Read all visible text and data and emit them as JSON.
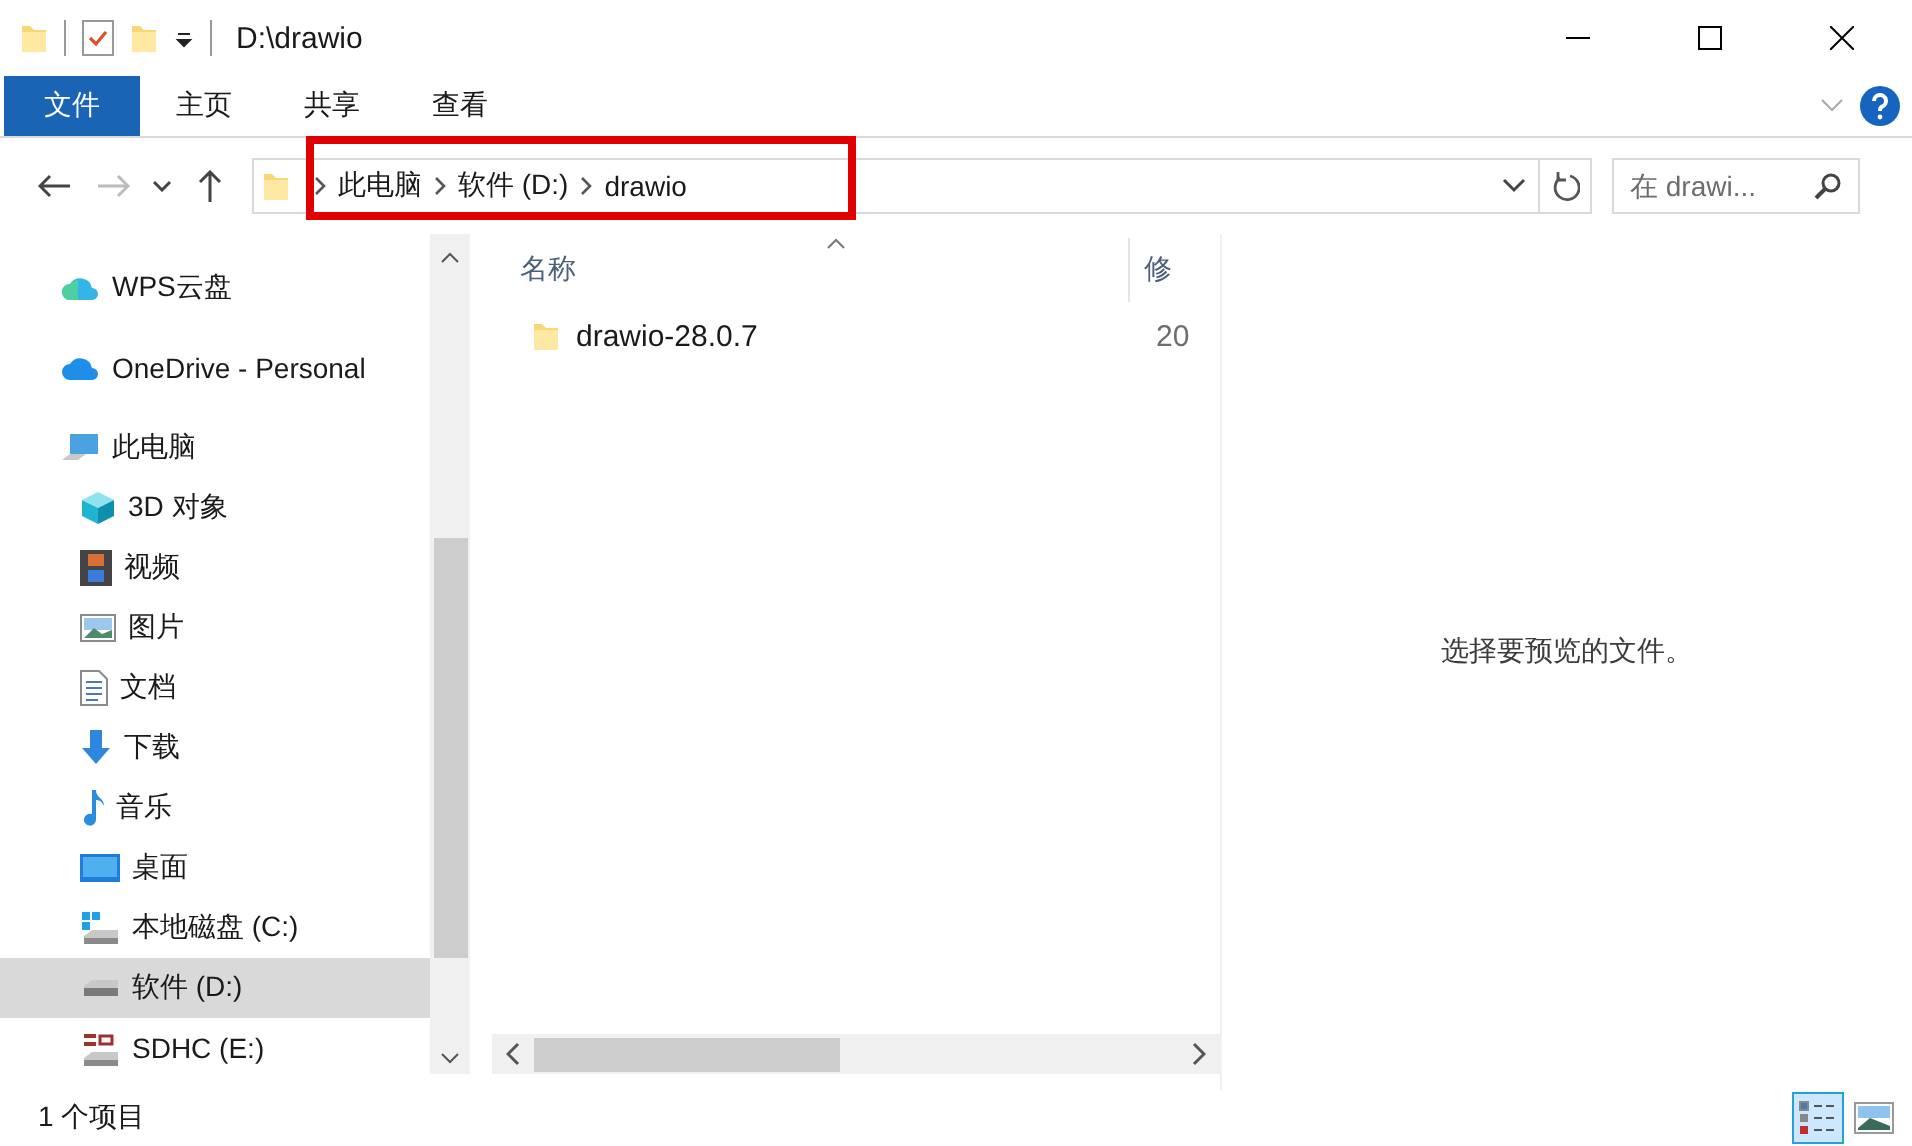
{
  "title_bar": {
    "title": "D:\\drawio"
  },
  "ribbon_tabs": [
    {
      "label": "文件",
      "selected": true
    },
    {
      "label": "主页",
      "selected": false
    },
    {
      "label": "共享",
      "selected": false
    },
    {
      "label": "查看",
      "selected": false
    }
  ],
  "address_bar": {
    "breadcrumbs": [
      "此电脑",
      "软件 (D:)",
      "drawio"
    ],
    "highlighted": true
  },
  "search": {
    "placeholder": "在 drawi..."
  },
  "nav_pane": {
    "items": [
      {
        "label": "WPS云盘",
        "kind": "cloud-wps",
        "selected": false
      },
      {
        "label": "OneDrive - Personal",
        "kind": "cloud",
        "selected": false
      },
      {
        "label": "此电脑",
        "kind": "computer",
        "selected": false,
        "children": [
          {
            "label": "3D 对象",
            "kind": "cube",
            "selected": false
          },
          {
            "label": "视频",
            "kind": "film",
            "selected": false
          },
          {
            "label": "图片",
            "kind": "image",
            "selected": false
          },
          {
            "label": "文档",
            "kind": "document",
            "selected": false
          },
          {
            "label": "下载",
            "kind": "download",
            "selected": false
          },
          {
            "label": "音乐",
            "kind": "music",
            "selected": false
          },
          {
            "label": "桌面",
            "kind": "desktop",
            "selected": false
          },
          {
            "label": "本地磁盘 (C:)",
            "kind": "system-drive",
            "selected": false
          },
          {
            "label": "软件 (D:)",
            "kind": "drive",
            "selected": true
          },
          {
            "label": "SDHC (E:)",
            "kind": "sd-card",
            "selected": false
          }
        ]
      }
    ]
  },
  "file_list": {
    "columns": [
      "名称",
      "修"
    ],
    "rows": [
      {
        "cells": [
          "drawio-28.0.7",
          "20"
        ],
        "selected": false
      }
    ]
  },
  "preview": {
    "message": "选择要预览的文件。"
  },
  "status_bar": {
    "item_count": "1 个项目",
    "views": [
      {
        "kind": "details",
        "selected": true
      },
      {
        "kind": "preview",
        "selected": false
      }
    ]
  }
}
